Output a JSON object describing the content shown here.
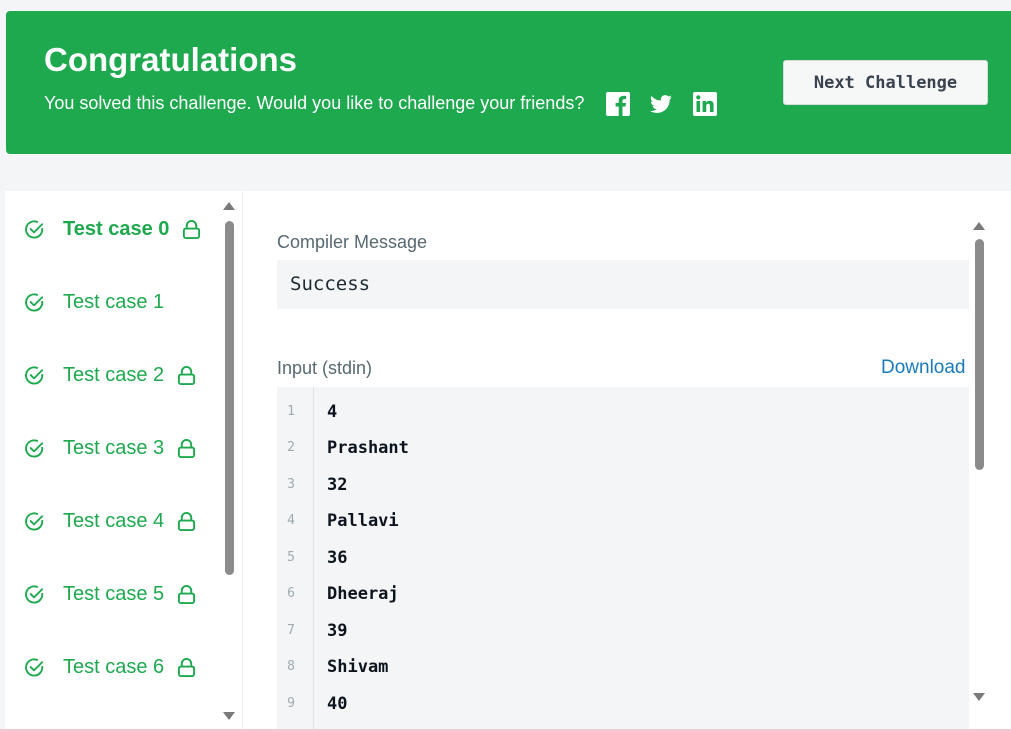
{
  "banner": {
    "title": "Congratulations",
    "subtitle": "You solved this challenge. Would you like to challenge your friends?",
    "social_icons": [
      "facebook-icon",
      "twitter-icon",
      "linkedin-icon"
    ],
    "next_button": "Next Challenge",
    "color": "#1ea94f"
  },
  "test_cases": [
    {
      "label": "Test case 0",
      "locked": true,
      "passed": true,
      "active": true
    },
    {
      "label": "Test case 1",
      "locked": false,
      "passed": true,
      "active": false
    },
    {
      "label": "Test case 2",
      "locked": true,
      "passed": true,
      "active": false
    },
    {
      "label": "Test case 3",
      "locked": true,
      "passed": true,
      "active": false
    },
    {
      "label": "Test case 4",
      "locked": true,
      "passed": true,
      "active": false
    },
    {
      "label": "Test case 5",
      "locked": true,
      "passed": true,
      "active": false
    },
    {
      "label": "Test case 6",
      "locked": true,
      "passed": true,
      "active": false
    }
  ],
  "compiler": {
    "label": "Compiler Message",
    "message": "Success"
  },
  "input": {
    "label": "Input (stdin)",
    "download": "Download",
    "lines": [
      {
        "num": "1",
        "text": "4"
      },
      {
        "num": "2",
        "text": "Prashant"
      },
      {
        "num": "3",
        "text": "32"
      },
      {
        "num": "4",
        "text": "Pallavi"
      },
      {
        "num": "5",
        "text": "36"
      },
      {
        "num": "6",
        "text": "Dheeraj"
      },
      {
        "num": "7",
        "text": "39"
      },
      {
        "num": "8",
        "text": "Shivam"
      },
      {
        "num": "9",
        "text": "40"
      }
    ]
  }
}
